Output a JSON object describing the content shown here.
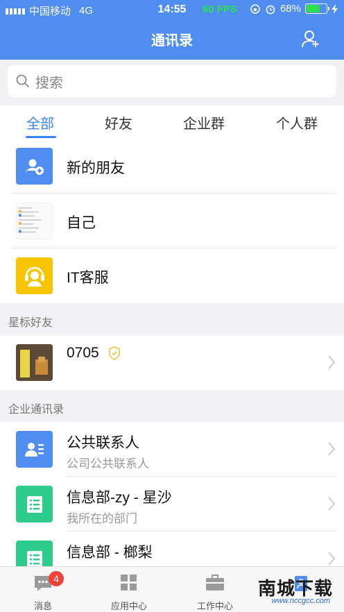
{
  "status_bar": {
    "carrier": "中国移动",
    "network": "4G",
    "time": "14:55",
    "fps": "60 FPS",
    "battery": "68%",
    "battery_level": 0.68
  },
  "header": {
    "title": "通讯录"
  },
  "search": {
    "placeholder": "搜索"
  },
  "tabs": [
    {
      "label": "全部",
      "active": true
    },
    {
      "label": "好友",
      "active": false
    },
    {
      "label": "企业群",
      "active": false
    },
    {
      "label": "个人群",
      "active": false
    }
  ],
  "top_items": [
    {
      "title": "新的朋友",
      "icon": "add-friend-icon",
      "color": "#4f8df1"
    },
    {
      "title": "自己",
      "icon": "self-thumbnail"
    },
    {
      "title": "IT客服",
      "icon": "customer-service-icon",
      "color": "#f6c500"
    }
  ],
  "starred": {
    "header": "星标好友",
    "items": [
      {
        "title": "0705"
      }
    ]
  },
  "enterprise": {
    "header": "企业通讯录",
    "items": [
      {
        "title": "公共联系人",
        "subtitle": "公司公共联系人",
        "icon": "contact-card-icon",
        "color": "#4f8df1"
      },
      {
        "title": "信息部-zy - 星沙",
        "subtitle": "我所在的部门",
        "icon": "department-icon",
        "color": "#2ecc8a"
      },
      {
        "title": "信息部 - 榔梨",
        "subtitle": "",
        "icon": "department-icon",
        "color": "#2ecc8a"
      }
    ]
  },
  "bottom_nav": [
    {
      "label": "消息",
      "badge": "4",
      "icon": "message-icon"
    },
    {
      "label": "应用中心",
      "icon": "apps-icon"
    },
    {
      "label": "工作中心",
      "icon": "briefcase-icon"
    },
    {
      "label": "",
      "icon": "contacts-icon",
      "active": true
    }
  ],
  "watermark": {
    "brand": "南城下载",
    "url": "www.nccgcc.com"
  },
  "colors": {
    "primary": "#4f8df1",
    "accent_blue": "#3b82f6",
    "green": "#2ecc8a",
    "yellow": "#f6c500",
    "badge_red": "#f04236",
    "fps_green": "#2ee04e"
  }
}
